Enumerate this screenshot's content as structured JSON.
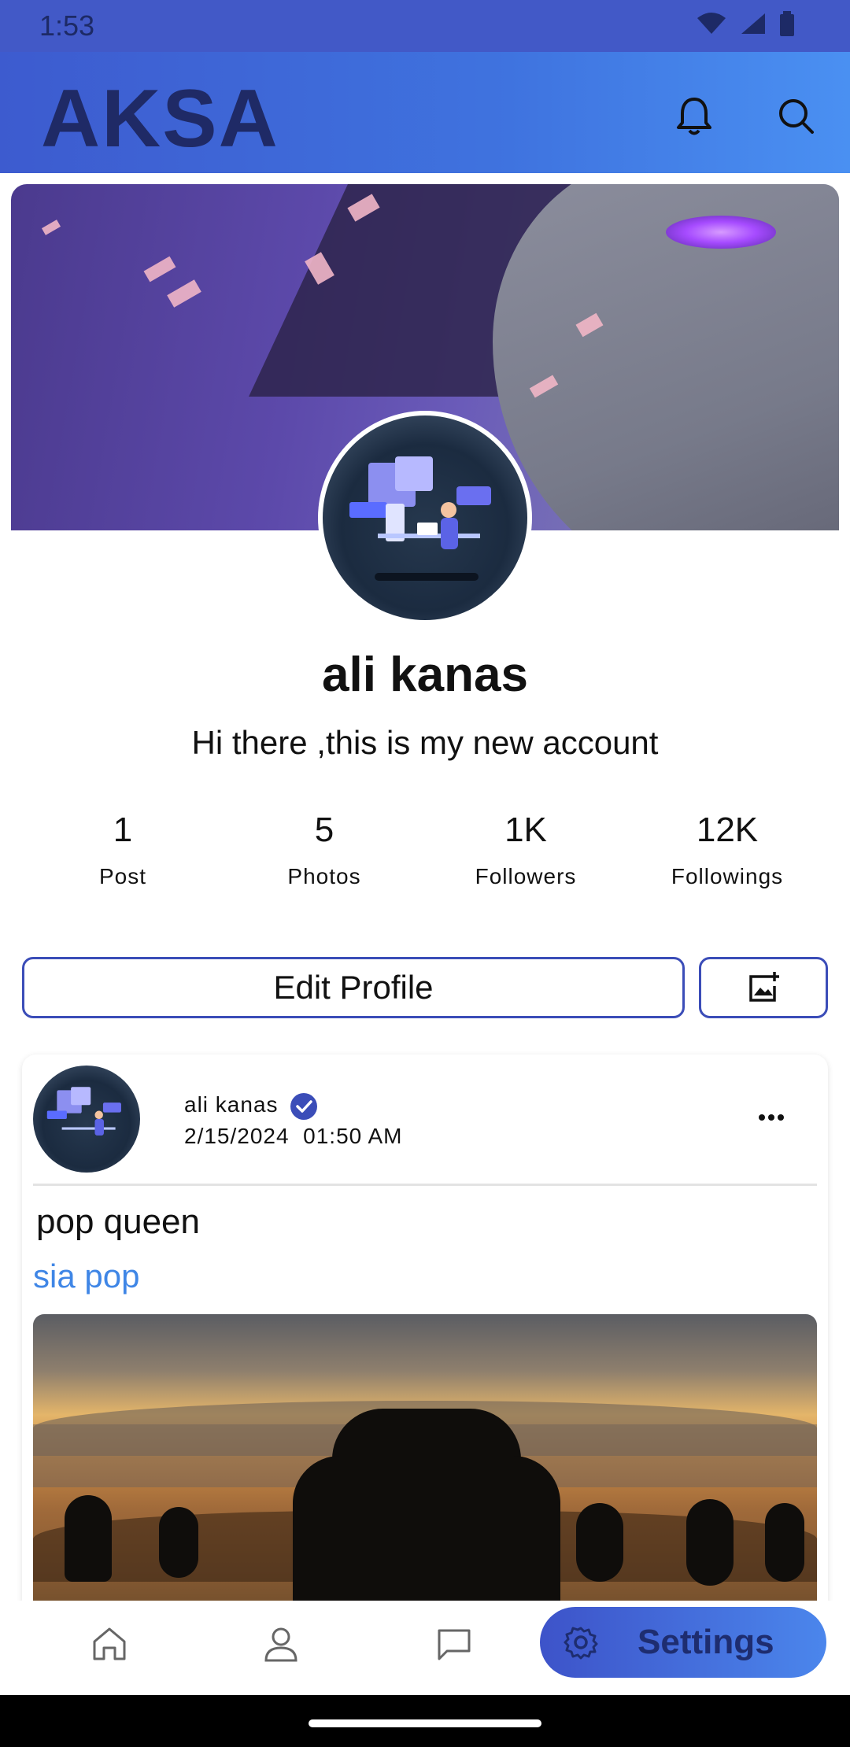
{
  "status_bar": {
    "time": "1:53"
  },
  "app_bar": {
    "title": "AKSA",
    "notification_icon": "bell-icon",
    "search_icon": "search-icon"
  },
  "profile": {
    "name": "ali kanas",
    "bio": "Hi there ,this is my new account",
    "stats": [
      {
        "value": "1",
        "label": "Post"
      },
      {
        "value": "5",
        "label": "Photos"
      },
      {
        "value": "1K",
        "label": "Followers"
      },
      {
        "value": "12K",
        "label": "Followings"
      }
    ],
    "edit_button": "Edit Profile",
    "add_photo_icon": "add-photo-icon"
  },
  "post": {
    "author": "ali kanas",
    "date": "2/15/2024",
    "time": "01:50 AM",
    "title": "pop queen",
    "tag": "sia pop",
    "more_icon": "more-horizontal-icon"
  },
  "bottom_nav": {
    "items": [
      "home-icon",
      "profile-icon",
      "chat-icon"
    ],
    "active": {
      "label": "Settings",
      "icon": "gear-icon"
    }
  },
  "colors": {
    "primary": "#3f5bcf",
    "accent": "#4a90f2",
    "link": "#3f86e6",
    "dark_text": "#1f2a66"
  }
}
